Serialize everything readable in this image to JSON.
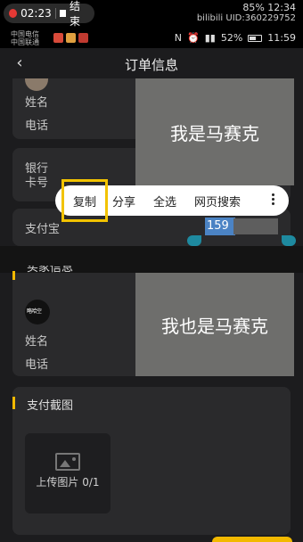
{
  "recording": {
    "time": "02:23",
    "stop_label": "结束"
  },
  "overlay": {
    "battery": "85%",
    "time": "12:34",
    "uid": "UID:360229752",
    "site": "bilibili"
  },
  "status_bar": {
    "carrier1": "中国电信",
    "carrier2": "中国联通",
    "battery": "52%",
    "time": "11:59"
  },
  "header": {
    "title": "订单信息"
  },
  "user_card": {
    "name_label": "姓名",
    "phone_label": "电话"
  },
  "bank_card": {
    "bank_label": "银行",
    "card_label": "卡号"
  },
  "alipay": {
    "label": "支付宝",
    "number_visible": "159"
  },
  "context_menu": {
    "items": [
      "复制",
      "分享",
      "全选",
      "网页搜索"
    ]
  },
  "mosaic": {
    "top_text": "我是马赛克",
    "bottom_text": "我也是马赛克"
  },
  "buyer_card": {
    "section_title": "买家信息",
    "avatar_text": "略哈空",
    "name_label": "姓名",
    "phone_label": "电话"
  },
  "screenshot_card": {
    "section_title": "支付截图",
    "upload_label": "上传图片 0/1"
  },
  "colors": {
    "accent": "#f2b900",
    "selection": "#4b83c4",
    "highlight_border": "#f2c300"
  }
}
